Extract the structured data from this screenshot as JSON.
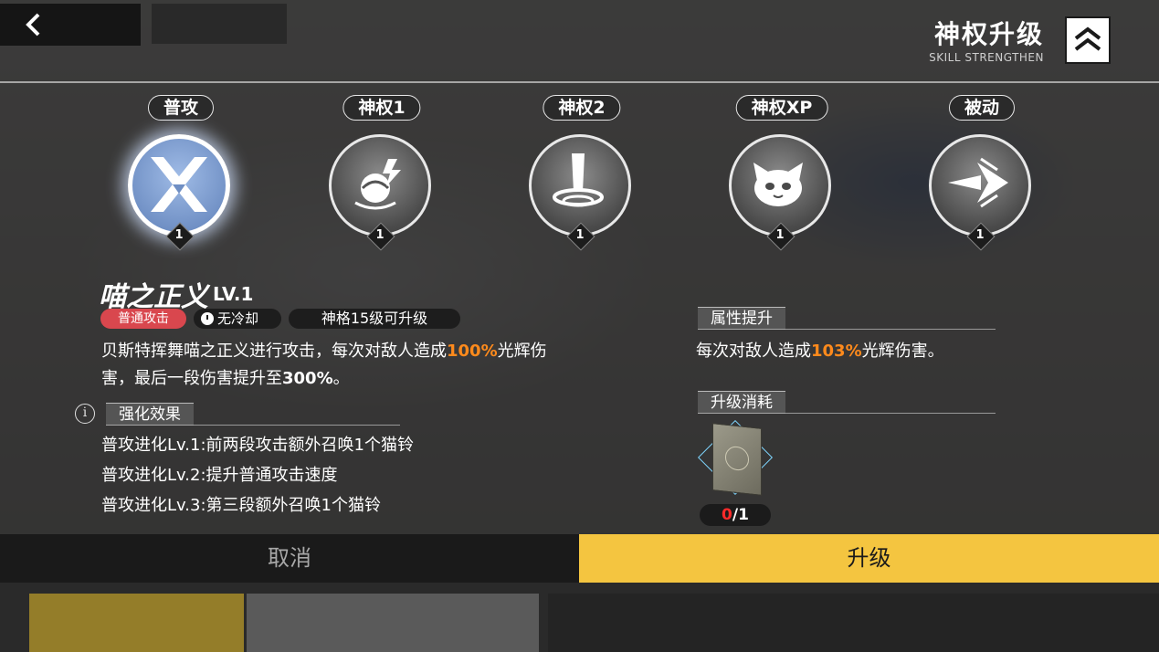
{
  "header": {
    "title": "神权升级",
    "subtitle": "SKILL STRENGTHEN"
  },
  "skills": [
    {
      "label": "普攻",
      "level": "1",
      "icon": "crossed-blades-icon",
      "selected": true
    },
    {
      "label": "神权1",
      "level": "1",
      "icon": "lightning-orb-icon",
      "selected": false
    },
    {
      "label": "神权2",
      "level": "1",
      "icon": "sword-vortex-icon",
      "selected": false
    },
    {
      "label": "神权XP",
      "level": "1",
      "icon": "cat-face-icon",
      "selected": false
    },
    {
      "label": "被动",
      "level": "1",
      "icon": "burst-arrow-icon",
      "selected": false
    }
  ],
  "detail": {
    "name": "喵之正义",
    "level": "LV.1",
    "tag_type": "普通攻击",
    "tag_cooldown": "无冷却",
    "tag_upgrade": "神格15级可升级",
    "desc_1": "贝斯特挥舞喵之正义进行攻击，每次对敌人造成",
    "desc_hl": "100%",
    "desc_2": "光辉伤",
    "desc_3": "害，最后一段伤害提升至",
    "desc_b": "300%",
    "desc_4": "。",
    "enhance_title": "强化效果",
    "evolutions": [
      "普攻进化Lv.1:前两段攻击额外召唤1个猫铃",
      "普攻进化Lv.2:提升普通攻击速度",
      "普攻进化Lv.3:第三段额外召唤1个猫铃"
    ]
  },
  "attribute": {
    "title": "属性提升",
    "text_1": "每次对敌人造成",
    "text_hl": "103%",
    "text_2": "光辉伤害。"
  },
  "cost": {
    "title": "升级消耗",
    "item_icon": "skill-book-icon",
    "owned": "0",
    "required": "/1"
  },
  "buttons": {
    "cancel": "取消",
    "upgrade": "升级"
  },
  "colors": {
    "accent": "#f4c540",
    "highlight": "#ff8a1c",
    "tag_red": "#d9474e",
    "selected_glow": "#9fbbe6"
  }
}
